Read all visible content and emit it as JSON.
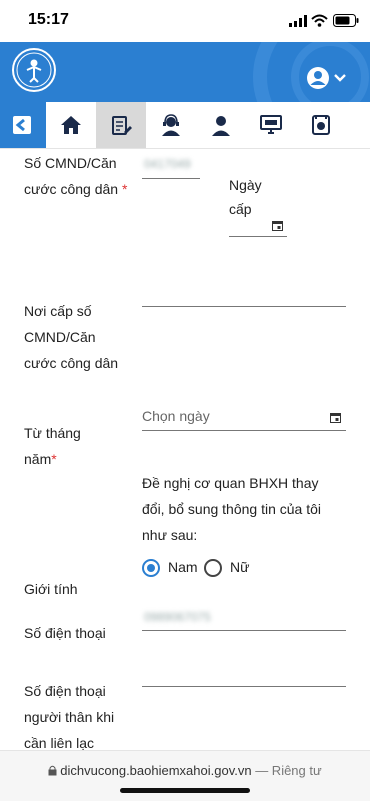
{
  "status_bar": {
    "time": "15:17"
  },
  "header": {
    "logo": "vss-logo-icon",
    "user": "user-circle-icon"
  },
  "toolbar": {
    "items": [
      "back-icon",
      "home-icon",
      "form-edit-icon",
      "support-agent-icon",
      "consultant-icon",
      "computer-icon",
      "media-icon"
    ],
    "active_index": 1
  },
  "form": {
    "id_number_label": "Số CMND/Căn cước công dân",
    "id_number_value": "0417049",
    "issue_date_label_1": "Ngày",
    "issue_date_label_2": "cấp",
    "issue_place_label": "Nơi cấp số CMND/Căn cước công dân",
    "from_month_label": "Từ tháng năm",
    "from_month_placeholder": "Chọn ngày",
    "request_text": "Đề nghị cơ quan BHXH thay đổi, bổ sung thông tin của tôi như sau:",
    "gender_label": "Giới tính",
    "gender_options": [
      "Nam",
      "Nữ"
    ],
    "gender_selected": "Nam",
    "phone_label": "Số điện thoại",
    "phone_value": "0989067075",
    "relative_phone_label": "Số điện thoại người thân khi cần liên lạc"
  },
  "browser": {
    "domain": "dichvucong.baohiemxahoi.gov.vn",
    "suffix": " — Riêng tư"
  },
  "colors": {
    "brand": "#2b7fd1",
    "required": "#d33333"
  }
}
